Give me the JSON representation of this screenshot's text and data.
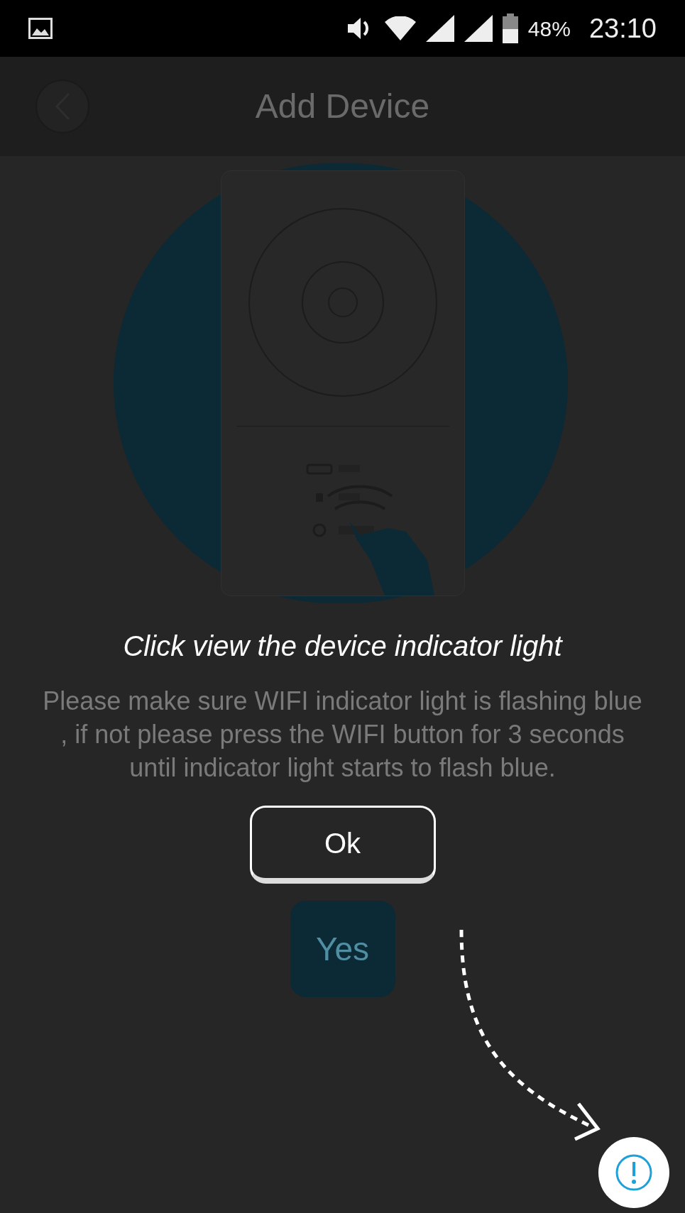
{
  "status_bar": {
    "battery": "48%",
    "time": "23:10"
  },
  "header": {
    "title": "Add Device"
  },
  "instruction": "Please make sure WIFI indicator light is flashing blue , if not please press the WIFI button for 3 seconds until indicator light starts to flash blue.",
  "confirm_button": "Yes",
  "coach_mark": {
    "tip": "Click view the device indicator light",
    "button": "Ok"
  }
}
